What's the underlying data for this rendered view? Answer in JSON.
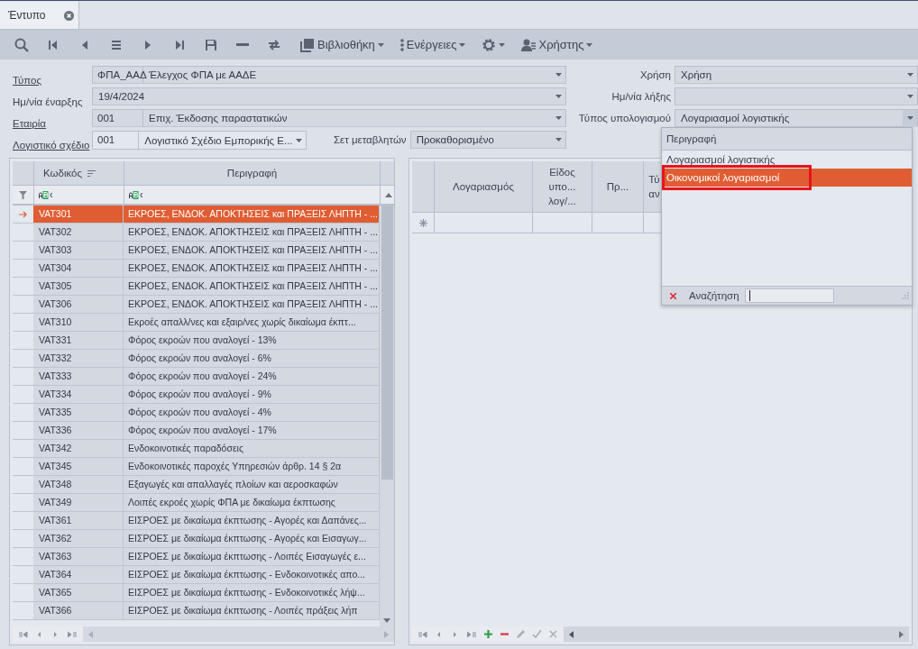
{
  "tabs": [
    {
      "label": "Έντυπο",
      "selected": true,
      "closable": true
    }
  ],
  "toolbar": {
    "menus": [
      {
        "kind": "library",
        "label": "Βιβλιοθήκη"
      },
      {
        "kind": "actions",
        "label": "Ενέργειες"
      },
      {
        "kind": "settings"
      },
      {
        "kind": "user",
        "label": "Χρήστης"
      }
    ]
  },
  "form": {
    "rows": [
      {
        "left": [
          {
            "label": "Τύπος",
            "link": true,
            "kind": "lookup",
            "code": "ΦΠΑ_ΑΑΔ",
            "value": "Έλεγχος ΦΠΑ με ΑΑΔΕ"
          }
        ],
        "right": {
          "label": "Χρήση",
          "kind": "combo",
          "value": "Χρήση"
        }
      },
      {
        "left": [
          {
            "label": "Ημ/νία έναρξης",
            "link": false,
            "kind": "combo",
            "value": "19/4/2024"
          }
        ],
        "right": {
          "label": "Ημ/νία λήξης",
          "kind": "combo"
        }
      },
      {
        "left": [
          {
            "label": "Εταιρία",
            "link": true,
            "kind": "lookup",
            "code": "001",
            "value": "Επιχ. Έκδοσης παραστατικών"
          }
        ],
        "right": {
          "label": "Τύπος υπολογισμού",
          "kind": "combo",
          "value": "Λογαριασμοί λογιστικής",
          "open": true
        }
      },
      {
        "left": [
          {
            "label": "Λογιστικό σχέδιο",
            "link": true,
            "kind": "lookup",
            "code": "001",
            "value": "Λογιστικό Σχέδιο Εμπορικής Ε..."
          },
          {
            "label": "Σετ μεταβλητών",
            "link": false,
            "kind": "combo",
            "value": "Προκαθορισμένο"
          }
        ]
      }
    ]
  },
  "left_grid": {
    "columns": [
      {
        "label": "Κωδικός",
        "sorted": true
      },
      {
        "label": "Περιγραφή",
        "sorted": false
      }
    ],
    "rows": [
      {
        "code": "VAT301",
        "description": "ΕΚΡΟΕΣ, ΕΝΔΟΚ. ΑΠΟΚΤΗΣΕΙΣ και ΠΡΑΞΕΙΣ ΛΗΠΤΗ - ...",
        "selected": true
      },
      {
        "code": "VAT302",
        "description": "ΕΚΡΟΕΣ, ΕΝΔΟΚ. ΑΠΟΚΤΗΣΕΙΣ και ΠΡΑΞΕΙΣ ΛΗΠΤΗ - ...",
        "selected": false
      },
      {
        "code": "VAT303",
        "description": "ΕΚΡΟΕΣ, ΕΝΔΟΚ. ΑΠΟΚΤΗΣΕΙΣ και ΠΡΑΞΕΙΣ ΛΗΠΤΗ - ...",
        "selected": false
      },
      {
        "code": "VAT304",
        "description": "ΕΚΡΟΕΣ, ΕΝΔΟΚ. ΑΠΟΚΤΗΣΕΙΣ και ΠΡΑΞΕΙΣ ΛΗΠΤΗ - ...",
        "selected": false
      },
      {
        "code": "VAT305",
        "description": "ΕΚΡΟΕΣ, ΕΝΔΟΚ. ΑΠΟΚΤΗΣΕΙΣ και ΠΡΑΞΕΙΣ ΛΗΠΤΗ - ...",
        "selected": false
      },
      {
        "code": "VAT306",
        "description": "ΕΚΡΟΕΣ, ΕΝΔΟΚ. ΑΠΟΚΤΗΣΕΙΣ και ΠΡΑΞΕΙΣ ΛΗΠΤΗ - ...",
        "selected": false
      },
      {
        "code": "VAT310",
        "description": "Εκροές απαλλ/νες και εξαιρ/νες χωρίς δικαίωμα έκπτ...",
        "selected": false
      },
      {
        "code": "VAT331",
        "description": "Φόρος εκροών που αναλογεί - 13%",
        "selected": false
      },
      {
        "code": "VAT332",
        "description": "Φόρος εκροών που αναλογεί - 6%",
        "selected": false
      },
      {
        "code": "VAT333",
        "description": "Φόρος εκροών που αναλογεί - 24%",
        "selected": false
      },
      {
        "code": "VAT334",
        "description": "Φόρος εκροών που αναλογεί - 9%",
        "selected": false
      },
      {
        "code": "VAT335",
        "description": "Φόρος εκροών που αναλογεί - 4%",
        "selected": false
      },
      {
        "code": "VAT336",
        "description": "Φόρος εκροών που αναλογεί - 17%",
        "selected": false
      },
      {
        "code": "VAT342",
        "description": "Ενδοκοινοτικές παραδόσεις",
        "selected": false
      },
      {
        "code": "VAT345",
        "description": "Ενδοκοινοτικές παροχές Υπηρεσιών άρθρ. 14 § 2α",
        "selected": false
      },
      {
        "code": "VAT348",
        "description": "Εξαγωγές και απαλλαγές πλοίων και αεροσκαφών",
        "selected": false
      },
      {
        "code": "VAT349",
        "description": "Λοιπές εκροές χωρίς ΦΠΑ με δικαίωμα έκπτωσης",
        "selected": false
      },
      {
        "code": "VAT361",
        "description": "ΕΙΣΡΟΕΣ με δικαίωμα έκπτωσης - Αγορές και Δαπάνες...",
        "selected": false
      },
      {
        "code": "VAT362",
        "description": "ΕΙΣΡΟΕΣ με δικαίωμα έκπτωσης - Αγορές και Εισαγωγ...",
        "selected": false
      },
      {
        "code": "VAT363",
        "description": "ΕΙΣΡΟΕΣ με δικαίωμα έκπτωσης - Λοιπές Εισαγωγές ε...",
        "selected": false
      },
      {
        "code": "VAT364",
        "description": "ΕΙΣΡΟΕΣ με δικαίωμα έκπτωσης - Ενδοκοινοτικές απο...",
        "selected": false
      },
      {
        "code": "VAT365",
        "description": "ΕΙΣΡΟΕΣ με δικαίωμα έκπτωσης - Ενδοκοινοτικές λήψ...",
        "selected": false
      },
      {
        "code": "VAT366",
        "description": "ΕΙΣΡΟΕΣ με δικαίωμα έκπτωσης - Λοιπές πράξεις λήπ",
        "selected": false
      }
    ]
  },
  "right_grid": {
    "columns": [
      "Λογαριασμός",
      "Είδος υπο... λογ/...",
      "Πρ...",
      "Τύ αν"
    ]
  },
  "dropdown": {
    "header": "Περιγραφή",
    "items": [
      {
        "label": "Λογαριασμοί λογιστικής",
        "selected": false,
        "highlighted": false
      },
      {
        "label": "Οικονομικοί λογαριασμοί",
        "selected": true,
        "highlighted": true
      }
    ],
    "search": {
      "label": "Αναζήτηση"
    }
  }
}
